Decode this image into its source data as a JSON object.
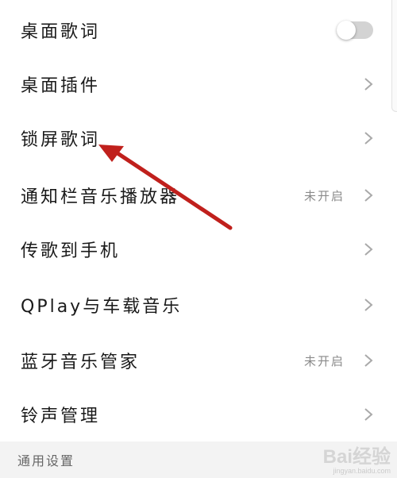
{
  "settings": {
    "items": [
      {
        "label": "桌面歌词",
        "control": "toggle",
        "toggle_on": false
      },
      {
        "label": "桌面插件",
        "control": "chevron"
      },
      {
        "label": "锁屏歌词",
        "control": "chevron"
      },
      {
        "label": "通知栏音乐播放器",
        "status": "未开启",
        "control": "chevron"
      },
      {
        "label": "传歌到手机",
        "control": "chevron"
      },
      {
        "label": "QPlay与车载音乐",
        "control": "chevron"
      },
      {
        "label": "蓝牙音乐管家",
        "status": "未开启",
        "control": "chevron"
      },
      {
        "label": "铃声管理",
        "control": "chevron"
      }
    ],
    "section_header": "通用设置"
  },
  "annotation": {
    "arrow_color": "#c0201c",
    "points_to": "锁屏歌词"
  },
  "watermark": {
    "logo": "Bai经验",
    "url": "jingyan.baidu.com"
  },
  "colors": {
    "background": "#ffffff",
    "section_background": "#f3f3f3",
    "text": "#1a1a1a",
    "status_text": "#8a8a8a",
    "toggle_off": "#d3d3d3"
  },
  "icons": {
    "chevron": "chevron-right-icon",
    "toggle": "toggle-switch"
  }
}
